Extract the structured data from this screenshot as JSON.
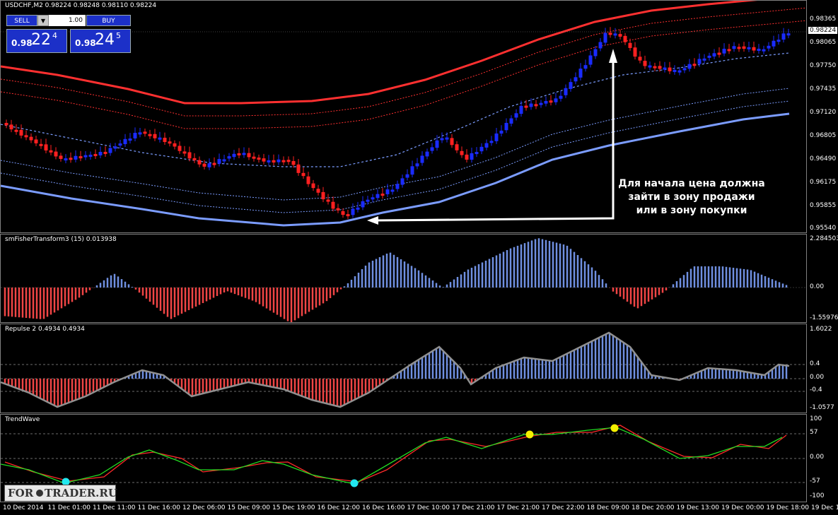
{
  "chart": {
    "symbol_header": "USDCHF,M2  0.98224 0.98248 0.98110 0.98224",
    "current_price": "0.98224",
    "price_ticks": [
      "0.98365",
      "0.98065",
      "0.97750",
      "0.97435",
      "0.97120",
      "0.96805",
      "0.96490",
      "0.96175",
      "0.95855",
      "0.95540"
    ]
  },
  "trade_panel": {
    "sell_label": "SELL",
    "buy_label": "BUY",
    "lot_value": "1.00",
    "spin_glyph": "▼",
    "bid_small": "0.98",
    "bid_big": "22",
    "bid_sup": "4",
    "ask_small": "0.98",
    "ask_big": "24",
    "ask_sup": "5"
  },
  "annotation": {
    "text": "Для начала цена должна зайти в зону продажи или в зону покупки"
  },
  "fisher": {
    "title": "smFisherTransform3 (15) 0.013938",
    "ticks": [
      "2.284503",
      "0.00",
      "-1.559768"
    ]
  },
  "repulse": {
    "title": "Repulse 2 0.4934 0.4934",
    "ticks": [
      "1.6022",
      "0.4",
      "0.00",
      "-0.4",
      "-1.0577"
    ]
  },
  "trendwave": {
    "title": "TrendWave",
    "ticks": [
      "100",
      "57",
      "0.00",
      "-57",
      "-100"
    ]
  },
  "time_axis": [
    "10 Dec 2014",
    "11 Dec 01:00",
    "11 Dec 11:00",
    "11 Dec 16:00",
    "12 Dec 06:00",
    "15 Dec 09:00",
    "15 Dec 19:00",
    "16 Dec 12:00",
    "16 Dec 16:00",
    "17 Dec 10:00",
    "17 Dec 21:00",
    "17 Dec 21:00",
    "17 Dec 22:00",
    "18 Dec 09:00",
    "18 Dec 20:00",
    "19 Dec 13:00",
    "19 Dec 00:00",
    "19 Dec 18:00",
    "19 Dec 18:00"
  ],
  "watermark": {
    "left": "FOR",
    "right": "TRADER.RU"
  },
  "colors": {
    "bull": "#1a2bff",
    "bear": "#ff2020",
    "band_upper": "#ff3030",
    "band_lower": "#7b9cff",
    "hist_pos": "#6f8fe0",
    "hist_neg": "#f04545",
    "wave_green": "#22dd22",
    "wave_red": "#ff2a2a",
    "dot_cyan": "#22e8f0",
    "dot_yellow": "#f5f000"
  }
}
